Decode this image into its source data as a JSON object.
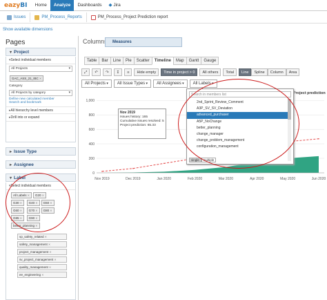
{
  "app": {
    "logo_main": "eazy",
    "logo_bi": "BI"
  },
  "topnav": {
    "home": "Home",
    "analyze": "Analyze",
    "dashboards": "Dashboards",
    "jira": "Jira"
  },
  "breadcrumb": {
    "issues": "Issues",
    "reports": "PM_Process_Reports",
    "report": "PM_Process_Project Prediction report"
  },
  "show_dims": "Show available dimensions",
  "pages": {
    "title": "Pages",
    "project": {
      "header": "Project",
      "select_label": "Select individual members",
      "all_projects": "All Projects",
      "selected_tag": "GAC_ASS_21_IBC",
      "category_label": "Category",
      "category_value": "All Projects by category",
      "link1": "Define new calculated member",
      "link2": "Search and bookmark",
      "hier_label": "All hierarchy level members",
      "drill_label": "Drill into or expand"
    },
    "issue_type": "Issue Type",
    "assignee": "Assignee",
    "label": {
      "header": "Label",
      "select_label": "Select individual members",
      "tags": [
        "All Labels",
        "G20",
        "G30",
        "G40",
        "G50",
        "G60",
        "G70",
        "G80",
        "G85",
        "G90",
        "better_planning"
      ],
      "vlist": [
        "vp_safety_related",
        "safety_management",
        "project_management",
        "sv_project_management",
        "quality_management",
        "ee_engineering"
      ]
    }
  },
  "columns": {
    "label": "Columns",
    "measures": "Measures"
  },
  "chart_tabs": [
    "Table",
    "Bar",
    "Line",
    "Pie",
    "Scatter",
    "Timeline",
    "Map",
    "Gantt",
    "Gauge"
  ],
  "active_tab": "Timeline",
  "toolbar": {
    "hide_empty": "Hide empty",
    "time_in_project": "Time in project > 0",
    "all_others": "All others",
    "total": "Total",
    "line": "Line",
    "spline": "Spline",
    "column": "Column",
    "area": "Area"
  },
  "filters": {
    "projects": "All Projects",
    "issue_types": "All Issue Types",
    "assignees": "All Assignees",
    "labels": "All Labels"
  },
  "proj_prediction_head": "Project prediction",
  "tooltip": {
    "title": "Nov 2019",
    "l1": "Issues history: 165",
    "l2": "Cumulative issues resolved: 5",
    "l3": "Project prediction: 65.33"
  },
  "dropdown": {
    "search_placeholder": "Search in members list",
    "items": [
      "2nd_Sprint_Review_Comment",
      "A3P_SV_SV_Deviation",
      "advanced_purchaser",
      "A5P_NoChange",
      "better_planning",
      "change_manager",
      "change_problem_management",
      "configuration_management"
    ],
    "highlighted": "advanced_purchaser",
    "mode_single": "single",
    "mode_multiple": "multiple"
  },
  "chart_data": {
    "type": "area",
    "x": [
      "Nov 2019",
      "Dec 2019",
      "Jan 2020",
      "Feb 2020",
      "Mar 2020",
      "Apr 2020",
      "May 2020",
      "Jun 2020"
    ],
    "y_ticks": [
      "1,000",
      "800",
      "600",
      "400",
      "200",
      "0"
    ],
    "ylim": [
      0,
      1050
    ],
    "series": [
      {
        "values": [
          0,
          5,
          15,
          40,
          80,
          150,
          200,
          230
        ],
        "color": "#1a9a76"
      },
      {
        "values": [
          20,
          60,
          130,
          200,
          280,
          360,
          430,
          470
        ],
        "color": "#e34a4a"
      }
    ],
    "grid": true
  }
}
